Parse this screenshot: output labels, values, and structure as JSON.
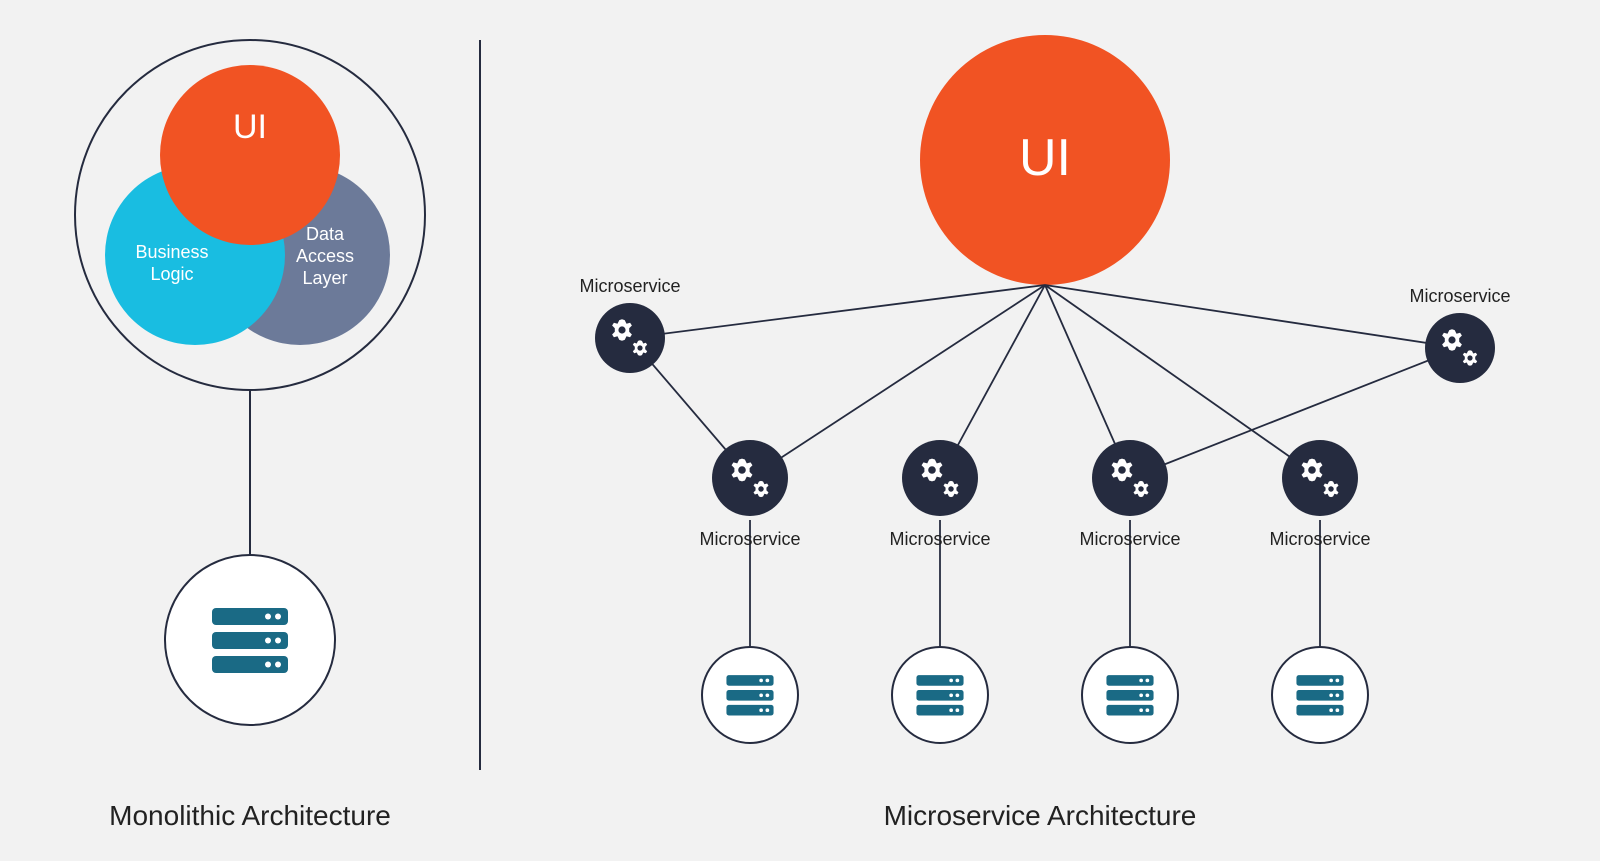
{
  "left": {
    "title": "Monolithic Architecture",
    "nodes": {
      "ui": "UI",
      "business": "Business Logic",
      "data": "Data Access Layer"
    }
  },
  "right": {
    "title": "Microservice Architecture",
    "ui_label": "UI",
    "ms_label": "Microservice"
  },
  "colors": {
    "orange": "#f15323",
    "cyan": "#19bde1",
    "slate": "#6c7a99",
    "navy": "#252b3f",
    "teal": "#1a6a85",
    "outline": "#252b3f"
  }
}
